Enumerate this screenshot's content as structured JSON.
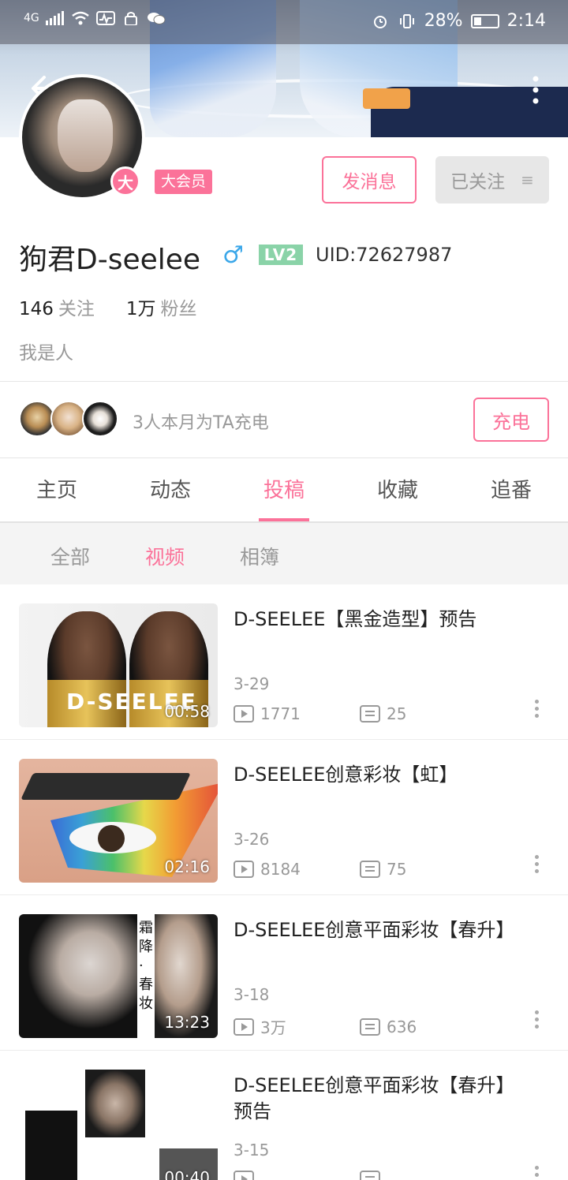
{
  "status_bar": {
    "network": "4G",
    "battery": "28%",
    "time": "2:14"
  },
  "profile": {
    "vip_badge_char": "大",
    "vip_label": "大会员",
    "message_button": "发消息",
    "follow_button": "已关注",
    "follow_button_icon": "≡",
    "username": "狗君D-seelee",
    "gender_symbol": "♂",
    "level": "LV2",
    "uid": "UID:72627987",
    "following_count": "146",
    "following_label": "关注",
    "followers_count": "1万",
    "followers_label": "粉丝",
    "bio": "我是人"
  },
  "charge": {
    "text": "3人本月为TA充电",
    "button": "充电"
  },
  "tabs": [
    {
      "label": "主页"
    },
    {
      "label": "动态"
    },
    {
      "label": "投稿"
    },
    {
      "label": "收藏"
    },
    {
      "label": "追番"
    }
  ],
  "active_tab": 2,
  "subtabs": [
    {
      "label": "全部"
    },
    {
      "label": "视频"
    },
    {
      "label": "相簿"
    }
  ],
  "active_subtab": 1,
  "videos": [
    {
      "title": "D-SEELEE【黑金造型】预告",
      "thumb_text": "D-SEELEE",
      "duration": "00:58",
      "date": "3-29",
      "views": "1771",
      "comments": "25"
    },
    {
      "title": "D-SEELEE创意彩妆【虹】",
      "duration": "02:16",
      "date": "3-26",
      "views": "8184",
      "comments": "75"
    },
    {
      "title": "D-SEELEE创意平面彩妆【春升】",
      "thumb_text": "霜降·春妆",
      "duration": "13:23",
      "date": "3-18",
      "views": "3万",
      "comments": "636"
    },
    {
      "title": "D-SEELEE创意平面彩妆【春升】预告",
      "duration": "00:40",
      "date": "3-15",
      "views": "",
      "comments": ""
    }
  ],
  "colors": {
    "accent": "#fb7299",
    "level_badge": "#8ad3a8",
    "gender": "#3ba7e9"
  },
  "icons": [
    "back-arrow-icon",
    "more-vertical-icon",
    "play-count-icon",
    "danmaku-icon",
    "more-dots-icon"
  ]
}
